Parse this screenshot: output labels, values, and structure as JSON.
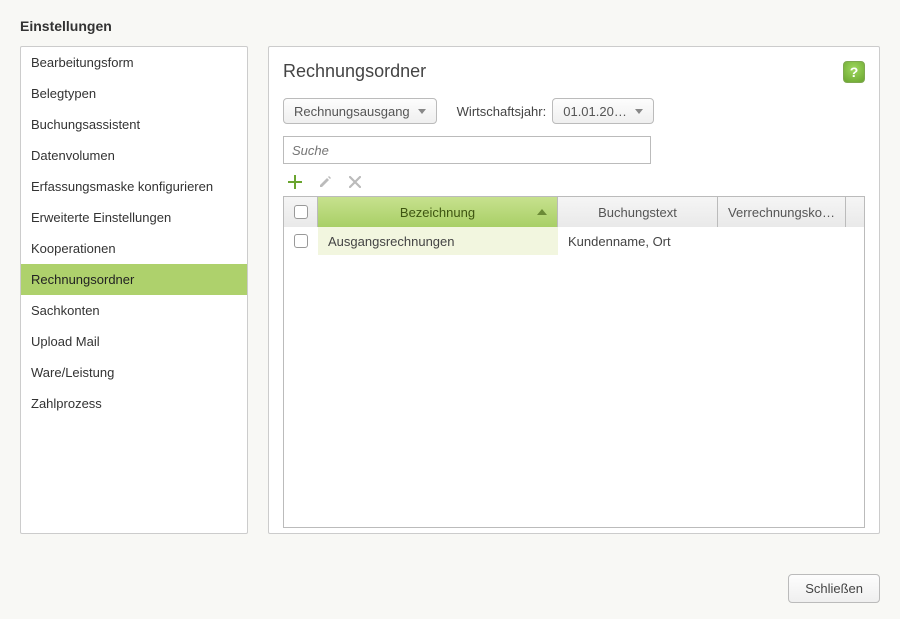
{
  "page_title": "Einstellungen",
  "sidebar": {
    "items": [
      {
        "label": "Bearbeitungsform",
        "active": false
      },
      {
        "label": "Belegtypen",
        "active": false
      },
      {
        "label": "Buchungsassistent",
        "active": false
      },
      {
        "label": "Datenvolumen",
        "active": false
      },
      {
        "label": "Erfassungsmaske konfigurieren",
        "active": false
      },
      {
        "label": "Erweiterte Einstellungen",
        "active": false
      },
      {
        "label": "Kooperationen",
        "active": false
      },
      {
        "label": "Rechnungsordner",
        "active": true
      },
      {
        "label": "Sachkonten",
        "active": false
      },
      {
        "label": "Upload Mail",
        "active": false
      },
      {
        "label": "Ware/Leistung",
        "active": false
      },
      {
        "label": "Zahlprozess",
        "active": false
      }
    ]
  },
  "panel": {
    "title": "Rechnungsordner",
    "help_tooltip": "?",
    "type_dropdown": {
      "selected": "Rechnungsausgang"
    },
    "fiscal_year_label": "Wirtschaftsjahr:",
    "fiscal_year_dropdown": {
      "selected": "01.01.20…"
    },
    "search": {
      "placeholder": "Suche",
      "value": ""
    },
    "toolbar": {
      "add_icon": "plus-icon",
      "edit_icon": "pencil-icon",
      "delete_icon": "x-icon"
    },
    "grid": {
      "columns": {
        "checkbox": "",
        "name": "Bezeichnung",
        "booking_text": "Buchungstext",
        "offset_account": "Verrechnungsko…"
      },
      "sort_column": "name",
      "sort_direction": "asc",
      "rows": [
        {
          "checked": false,
          "name": "Ausgangsrechnungen",
          "booking_text": "Kundenname, Ort",
          "offset_account": ""
        }
      ]
    }
  },
  "footer": {
    "close_label": "Schließen"
  }
}
